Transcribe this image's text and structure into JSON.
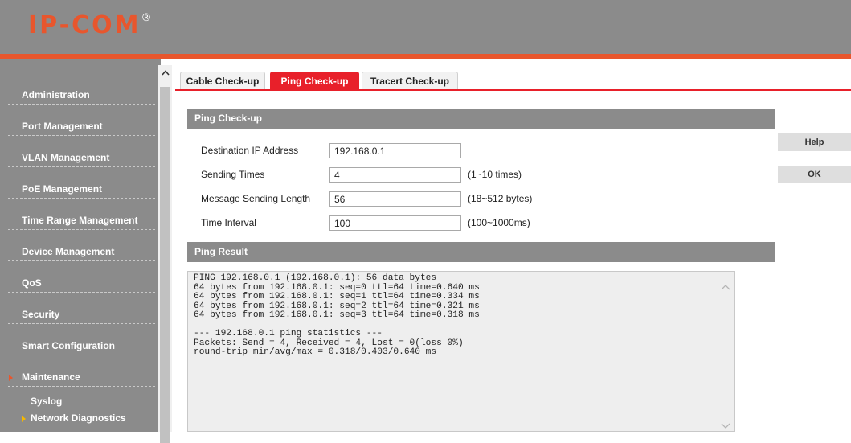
{
  "header": {
    "logo_text": "IP-COM",
    "logo_mark": "®",
    "brand_color": "#e8562d"
  },
  "sidebar": {
    "items": [
      {
        "label": "Administration"
      },
      {
        "label": "Port Management"
      },
      {
        "label": "VLAN Management"
      },
      {
        "label": "PoE Management"
      },
      {
        "label": "Time Range Management"
      },
      {
        "label": "Device Management"
      },
      {
        "label": "QoS"
      },
      {
        "label": "Security"
      },
      {
        "label": "Smart Configuration"
      },
      {
        "label": "Maintenance",
        "active": true
      }
    ],
    "sub_items": [
      {
        "label": "Syslog"
      },
      {
        "label": "Network Diagnostics",
        "active": true
      }
    ]
  },
  "tabs": [
    {
      "label": "Cable Check-up",
      "active": false
    },
    {
      "label": "Ping Check-up",
      "active": true
    },
    {
      "label": "Tracert Check-up",
      "active": false
    }
  ],
  "ping_section": {
    "title": "Ping Check-up",
    "fields": [
      {
        "label": "Destination IP Address",
        "value": "192.168.0.1",
        "hint": ""
      },
      {
        "label": "Sending Times",
        "value": "4",
        "hint": "(1~10 times)"
      },
      {
        "label": "Message Sending Length",
        "value": "56",
        "hint": "(18~512 bytes)"
      },
      {
        "label": "Time Interval",
        "value": "100",
        "hint": "(100~1000ms)"
      }
    ]
  },
  "buttons": {
    "help": "Help",
    "ok": "OK"
  },
  "result_section": {
    "title": "Ping Result",
    "lines": [
      "PING 192.168.0.1 (192.168.0.1): 56 data bytes",
      "64 bytes from 192.168.0.1: seq=0 ttl=64 time=0.640 ms",
      "64 bytes from 192.168.0.1: seq=1 ttl=64 time=0.334 ms",
      "64 bytes from 192.168.0.1: seq=2 ttl=64 time=0.321 ms",
      "64 bytes from 192.168.0.1: seq=3 ttl=64 time=0.318 ms",
      "",
      "--- 192.168.0.1 ping statistics ---",
      "Packets: Send = 4, Received = 4, Lost = 0(loss 0%)",
      "round-trip min/avg/max = 0.318/0.403/0.640 ms"
    ]
  },
  "colors": {
    "accent_red": "#e8202a",
    "sidebar_gray": "#8b8b8b"
  }
}
